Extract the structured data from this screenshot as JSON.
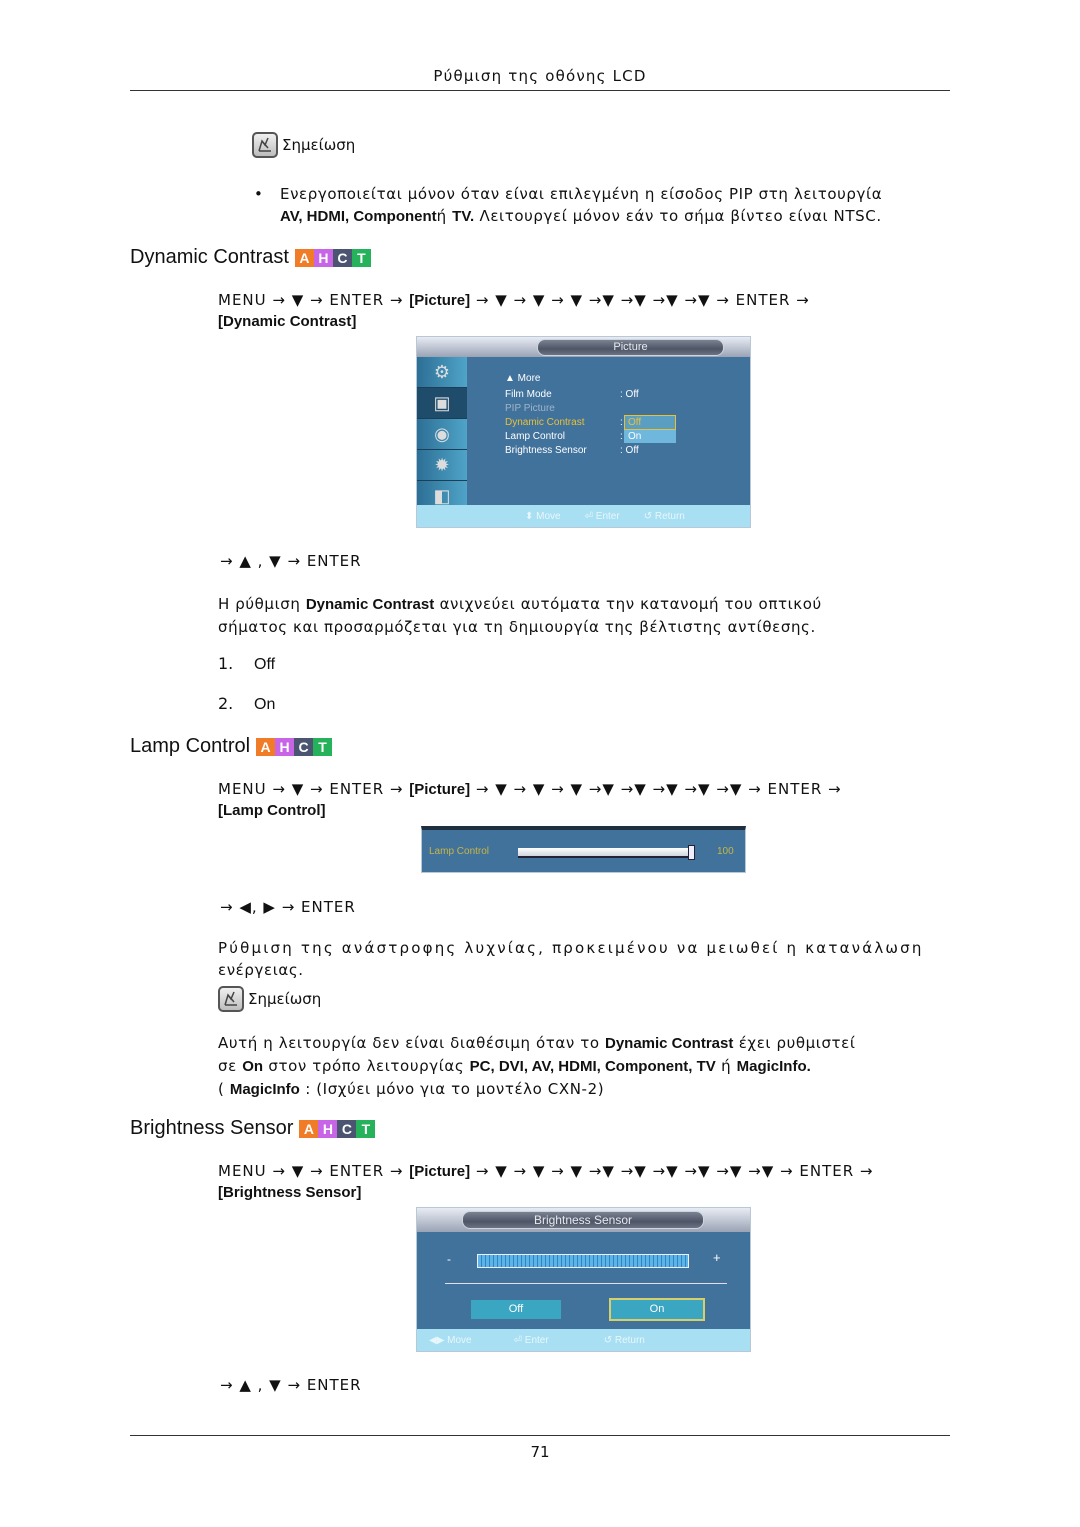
{
  "header": {
    "title": "Ρύθμιση της οθόνης LCD"
  },
  "badge": {
    "letters": [
      "A",
      "H",
      "C",
      "T"
    ],
    "colors": [
      "#f07c28",
      "#c865e6",
      "#4b5470",
      "#26b25a"
    ]
  },
  "note1": {
    "label": "Σημείωση",
    "bullet": "•",
    "line1": "Ενεργοποιείται μόνον όταν είναι επιλεγμένη η είσοδος PIP στη λειτουργία",
    "line2_bold": "AV, HDMI, Component",
    "line2_mid": "ή",
    "line2_bold2": "TV.",
    "line2_rest": " Λειτουργεί μόνον εάν το σήμα βίντεο είναι NTSC."
  },
  "dynamic_contrast": {
    "title": "Dynamic Contrast",
    "path_prefix": "MENU → ▼ → ENTER →",
    "path_picture": "[Picture]",
    "path_suffix": "→ ▼ → ▼ → ▼ →▼ →▼ →▼ →▼ → ENTER →",
    "path_target": "[Dynamic Contrast]",
    "osd": {
      "title": "Picture",
      "more": "▲ More",
      "items": [
        {
          "label": "Film Mode",
          "value": ": Off",
          "state": "normal"
        },
        {
          "label": "PIP Picture",
          "value": "",
          "state": "disabled"
        },
        {
          "label": "Dynamic Contrast",
          "value": ":",
          "state": "selected"
        },
        {
          "label": "Lamp Control",
          "value": ":",
          "state": "normal"
        },
        {
          "label": "Brightness Sensor",
          "value": ": Off",
          "state": "normal"
        }
      ],
      "dropdown": [
        "Off",
        "On"
      ],
      "dropdown_selected": "Off",
      "footer": [
        "⬍ Move",
        "⏎ Enter",
        "↺ Return"
      ]
    },
    "nav": "→ ▲ , ▼ → ENTER",
    "desc_pre": "Η ρύθμιση ",
    "desc_bold": "Dynamic Contrast",
    "desc_line1_rest": " ανιχνεύει αυτόματα την κατανομή του οπτικού",
    "desc_line2": "σήματος και προσαρμόζεται για τη δημιουργία της βέλτιστης αντίθεσης.",
    "options": [
      {
        "num": "1.",
        "label": "Off"
      },
      {
        "num": "2.",
        "label": "On"
      }
    ]
  },
  "lamp_control": {
    "title": "Lamp Control",
    "path_prefix": "MENU → ▼ → ENTER →",
    "path_picture": "[Picture]",
    "path_suffix": "→ ▼ → ▼ → ▼ →▼ →▼ →▼ →▼ →▼ → ENTER →",
    "path_target": "[Lamp Control]",
    "osd": {
      "label": "Lamp Control",
      "value": "100",
      "level_percent": 100
    },
    "nav": "→ ◀, ▶ → ENTER",
    "desc_line1": "Ρύθμιση της ανάστροφης λυχνίας, προκειμένου να μειωθεί η κατανάλωση",
    "desc_line2": "ενέργειας.",
    "note": {
      "label": "Σημείωση",
      "l1_pre": "Αυτή η λειτουργία δεν είναι διαθέσιμη όταν το ",
      "l1_bold": "Dynamic Contrast",
      "l1_post": " έχει ρυθμιστεί",
      "l2_pre": "σε ",
      "l2_bold1": "On",
      "l2_mid": " στον τρόπο λειτουργίας ",
      "l2_bold2": "PC, DVI, AV, HDMI, Component, TV",
      "l2_mid2": " ή ",
      "l2_bold3": "MagicInfo.",
      "l3_pre": "( ",
      "l3_bold": "MagicInfo",
      "l3_post": " : (Ισχύει μόνο για το μοντέλο CXN-2)"
    }
  },
  "brightness_sensor": {
    "title": "Brightness Sensor",
    "path_prefix": "MENU → ▼ → ENTER →",
    "path_picture": "[Picture]",
    "path_suffix": "→ ▼ → ▼ → ▼ →▼ →▼ →▼ →▼ →▼ →▼ → ENTER →",
    "path_target": "[Brightness Sensor]",
    "osd": {
      "title": "Brightness Sensor",
      "minus": "-",
      "plus": "+",
      "buttons": [
        "Off",
        "On"
      ],
      "selected": "On",
      "footer": [
        "◀▶ Move",
        "⏎ Enter",
        "↺ Return"
      ]
    },
    "nav": "→ ▲ , ▼ → ENTER"
  },
  "footer": {
    "page_number": "71"
  }
}
